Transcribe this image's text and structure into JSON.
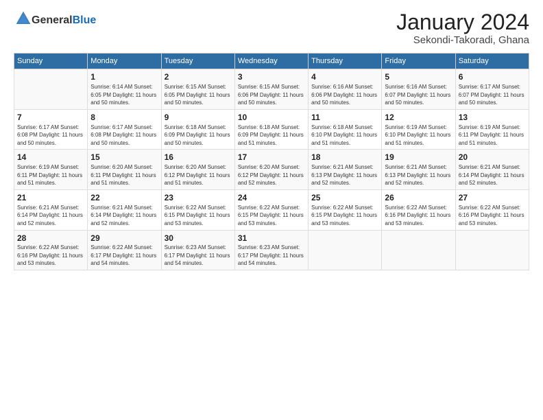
{
  "header": {
    "logo": {
      "general": "General",
      "blue": "Blue"
    },
    "title": "January 2024",
    "location": "Sekondi-Takoradi, Ghana"
  },
  "days_of_week": [
    "Sunday",
    "Monday",
    "Tuesday",
    "Wednesday",
    "Thursday",
    "Friday",
    "Saturday"
  ],
  "weeks": [
    [
      {
        "day": "",
        "info": ""
      },
      {
        "day": "1",
        "info": "Sunrise: 6:14 AM\nSunset: 6:05 PM\nDaylight: 11 hours\nand 50 minutes."
      },
      {
        "day": "2",
        "info": "Sunrise: 6:15 AM\nSunset: 6:05 PM\nDaylight: 11 hours\nand 50 minutes."
      },
      {
        "day": "3",
        "info": "Sunrise: 6:15 AM\nSunset: 6:06 PM\nDaylight: 11 hours\nand 50 minutes."
      },
      {
        "day": "4",
        "info": "Sunrise: 6:16 AM\nSunset: 6:06 PM\nDaylight: 11 hours\nand 50 minutes."
      },
      {
        "day": "5",
        "info": "Sunrise: 6:16 AM\nSunset: 6:07 PM\nDaylight: 11 hours\nand 50 minutes."
      },
      {
        "day": "6",
        "info": "Sunrise: 6:17 AM\nSunset: 6:07 PM\nDaylight: 11 hours\nand 50 minutes."
      }
    ],
    [
      {
        "day": "7",
        "info": "Sunrise: 6:17 AM\nSunset: 6:08 PM\nDaylight: 11 hours\nand 50 minutes."
      },
      {
        "day": "8",
        "info": "Sunrise: 6:17 AM\nSunset: 6:08 PM\nDaylight: 11 hours\nand 50 minutes."
      },
      {
        "day": "9",
        "info": "Sunrise: 6:18 AM\nSunset: 6:09 PM\nDaylight: 11 hours\nand 50 minutes."
      },
      {
        "day": "10",
        "info": "Sunrise: 6:18 AM\nSunset: 6:09 PM\nDaylight: 11 hours\nand 51 minutes."
      },
      {
        "day": "11",
        "info": "Sunrise: 6:18 AM\nSunset: 6:10 PM\nDaylight: 11 hours\nand 51 minutes."
      },
      {
        "day": "12",
        "info": "Sunrise: 6:19 AM\nSunset: 6:10 PM\nDaylight: 11 hours\nand 51 minutes."
      },
      {
        "day": "13",
        "info": "Sunrise: 6:19 AM\nSunset: 6:11 PM\nDaylight: 11 hours\nand 51 minutes."
      }
    ],
    [
      {
        "day": "14",
        "info": "Sunrise: 6:19 AM\nSunset: 6:11 PM\nDaylight: 11 hours\nand 51 minutes."
      },
      {
        "day": "15",
        "info": "Sunrise: 6:20 AM\nSunset: 6:11 PM\nDaylight: 11 hours\nand 51 minutes."
      },
      {
        "day": "16",
        "info": "Sunrise: 6:20 AM\nSunset: 6:12 PM\nDaylight: 11 hours\nand 51 minutes."
      },
      {
        "day": "17",
        "info": "Sunrise: 6:20 AM\nSunset: 6:12 PM\nDaylight: 11 hours\nand 52 minutes."
      },
      {
        "day": "18",
        "info": "Sunrise: 6:21 AM\nSunset: 6:13 PM\nDaylight: 11 hours\nand 52 minutes."
      },
      {
        "day": "19",
        "info": "Sunrise: 6:21 AM\nSunset: 6:13 PM\nDaylight: 11 hours\nand 52 minutes."
      },
      {
        "day": "20",
        "info": "Sunrise: 6:21 AM\nSunset: 6:14 PM\nDaylight: 11 hours\nand 52 minutes."
      }
    ],
    [
      {
        "day": "21",
        "info": "Sunrise: 6:21 AM\nSunset: 6:14 PM\nDaylight: 11 hours\nand 52 minutes."
      },
      {
        "day": "22",
        "info": "Sunrise: 6:21 AM\nSunset: 6:14 PM\nDaylight: 11 hours\nand 52 minutes."
      },
      {
        "day": "23",
        "info": "Sunrise: 6:22 AM\nSunset: 6:15 PM\nDaylight: 11 hours\nand 53 minutes."
      },
      {
        "day": "24",
        "info": "Sunrise: 6:22 AM\nSunset: 6:15 PM\nDaylight: 11 hours\nand 53 minutes."
      },
      {
        "day": "25",
        "info": "Sunrise: 6:22 AM\nSunset: 6:15 PM\nDaylight: 11 hours\nand 53 minutes."
      },
      {
        "day": "26",
        "info": "Sunrise: 6:22 AM\nSunset: 6:16 PM\nDaylight: 11 hours\nand 53 minutes."
      },
      {
        "day": "27",
        "info": "Sunrise: 6:22 AM\nSunset: 6:16 PM\nDaylight: 11 hours\nand 53 minutes."
      }
    ],
    [
      {
        "day": "28",
        "info": "Sunrise: 6:22 AM\nSunset: 6:16 PM\nDaylight: 11 hours\nand 53 minutes."
      },
      {
        "day": "29",
        "info": "Sunrise: 6:22 AM\nSunset: 6:17 PM\nDaylight: 11 hours\nand 54 minutes."
      },
      {
        "day": "30",
        "info": "Sunrise: 6:23 AM\nSunset: 6:17 PM\nDaylight: 11 hours\nand 54 minutes."
      },
      {
        "day": "31",
        "info": "Sunrise: 6:23 AM\nSunset: 6:17 PM\nDaylight: 11 hours\nand 54 minutes."
      },
      {
        "day": "",
        "info": ""
      },
      {
        "day": "",
        "info": ""
      },
      {
        "day": "",
        "info": ""
      }
    ]
  ]
}
